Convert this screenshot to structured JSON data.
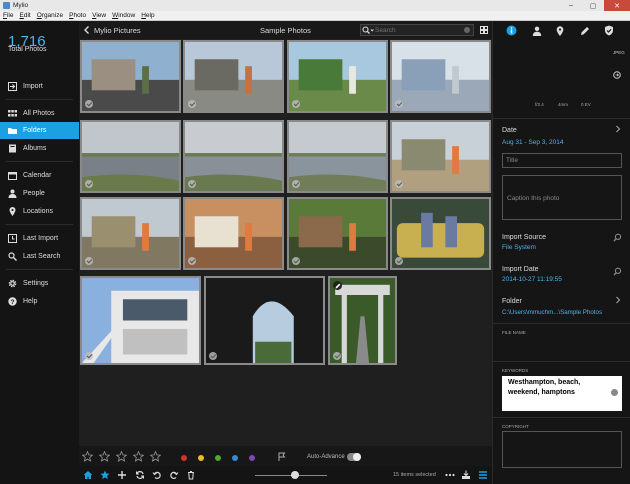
{
  "window": {
    "title": "Mylio",
    "controls": [
      "–",
      "▢",
      "✕"
    ]
  },
  "menu": [
    "File",
    "Edit",
    "Organize",
    "Photo",
    "View",
    "Window",
    "Help"
  ],
  "sidebar": {
    "count": "1,716",
    "count_label": "Total Photos",
    "items": [
      {
        "label": "Import",
        "icon": "import-icon"
      },
      {
        "label": "All Photos",
        "icon": "grid-icon"
      },
      {
        "label": "Folders",
        "icon": "folder-icon",
        "active": true
      },
      {
        "label": "Albums",
        "icon": "albums-icon"
      },
      {
        "label": "Calendar",
        "icon": "calendar-icon"
      },
      {
        "label": "People",
        "icon": "person-icon"
      },
      {
        "label": "Locations",
        "icon": "pin-icon"
      },
      {
        "label": "Last Import",
        "icon": "last-import-icon"
      },
      {
        "label": "Last Search",
        "icon": "search-icon"
      },
      {
        "label": "Settings",
        "icon": "gear-icon"
      },
      {
        "label": "Help",
        "icon": "help-icon"
      }
    ]
  },
  "topnav": {
    "location": "Mylio Pictures",
    "folder_title": "Sample Photos",
    "search_placeholder": "Search"
  },
  "photos": [
    {
      "scene": "street",
      "colors": [
        "#8fb0cf",
        "#9a8f80",
        "#5a6e4a",
        "#4a4a4a"
      ]
    },
    {
      "scene": "storefront",
      "colors": [
        "#b8c8d8",
        "#6a6a62",
        "#c87040",
        "#8a8a84"
      ]
    },
    {
      "scene": "gazebo",
      "colors": [
        "#a8c8e0",
        "#4a7a3a",
        "#e8e8e0",
        "#6a8a4a"
      ]
    },
    {
      "scene": "shop-window",
      "colors": [
        "#d8e0e8",
        "#8aa0b8",
        "#c0c8d0",
        "#9aa8b8"
      ]
    },
    {
      "scene": "marsh",
      "colors": [
        "#c0c6cc",
        "#7a8088",
        "#6a7a4a",
        "#5a6870"
      ]
    },
    {
      "scene": "marsh",
      "colors": [
        "#c8ccd0",
        "#8a9098",
        "#6a7a50",
        "#606870"
      ]
    },
    {
      "scene": "marsh",
      "colors": [
        "#c4cad0",
        "#8a949c",
        "#707c5a",
        "#606a72"
      ]
    },
    {
      "scene": "beach-path",
      "colors": [
        "#c8d0d8",
        "#8a8a70",
        "#e07a40",
        "#b0a080"
      ]
    },
    {
      "scene": "beach-sign",
      "colors": [
        "#c0c8d0",
        "#9a9070",
        "#e07a40",
        "#807860"
      ]
    },
    {
      "scene": "porch",
      "colors": [
        "#c89060",
        "#e8e0d0",
        "#e07a40",
        "#8a6040"
      ]
    },
    {
      "scene": "garden-sign",
      "colors": [
        "#5a7a3a",
        "#8a6a4a",
        "#e07a40",
        "#3a4a2a"
      ]
    },
    {
      "scene": "couch",
      "colors": [
        "#3a4a3a",
        "#c8b050",
        "#6a7aa0",
        "#403830"
      ]
    },
    {
      "scene": "building",
      "colors": [
        "#8ab0e0",
        "#e8e8e8",
        "#4a5a6a",
        "#c0c0c0"
      ]
    },
    {
      "scene": "arch",
      "colors": [
        "#1a1a1a",
        "#b8cce0",
        "#4a6a3a",
        "#2a2a2a"
      ]
    },
    {
      "scene": "pergola",
      "colors": [
        "#3a5a2a",
        "#d8d8d8",
        "#6a8a4a",
        "#8a8a8a"
      ]
    }
  ],
  "bottom": {
    "stars": 5,
    "color_labels": [
      "#d0342c",
      "#e8c020",
      "#50a830",
      "#3a8ad0",
      "#7a4ab0"
    ],
    "auto_advance": "Auto-Advance",
    "auto_advance_on": true,
    "zoom": 0.55,
    "selected_text": "15 items selected"
  },
  "panel": {
    "format": "JPEG",
    "meta": [
      "f/2.4",
      "4mm",
      "0 EV"
    ],
    "date_label": "Date",
    "date_value": "Aug 31 - Sep 3, 2014",
    "title_placeholder": "Title",
    "caption_placeholder": "Caption this photo",
    "import_source_label": "Import Source",
    "import_source_value": "File System",
    "import_date_label": "Import Date",
    "import_date_value": "2014-10-27 11:19:55",
    "folder_label": "Folder",
    "folder_value": "C:\\Users\\mmuchm...\\Sample Photos",
    "file_name_label": "FILE NAME",
    "keywords_label": "KEYWORDS",
    "keywords_value": "Westhampton, beach, weekend, hamptons",
    "copyright_label": "COPYRIGHT"
  }
}
